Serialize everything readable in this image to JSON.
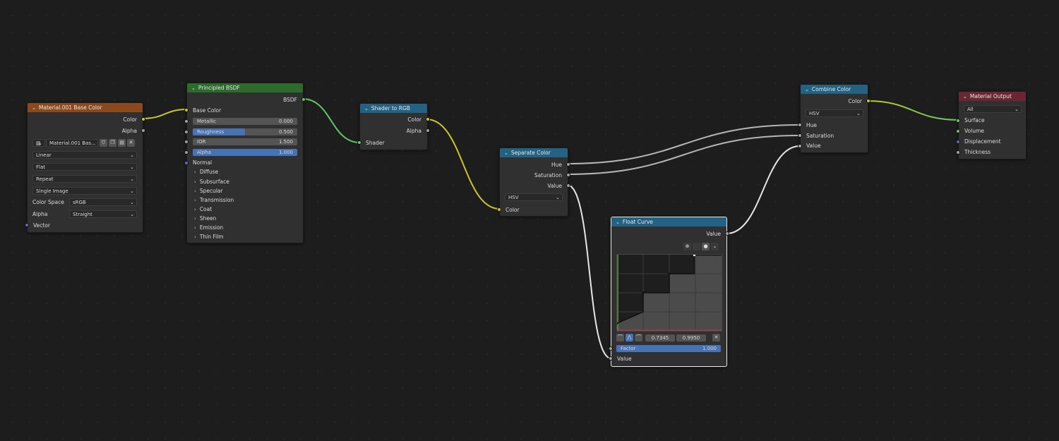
{
  "colors": {
    "wire_yellow": "#c7c729",
    "wire_green": "#63c763",
    "wire_grey": "#b5b5b5",
    "wire_white": "#e6e6e6",
    "accent": "#4772b3"
  },
  "image_node": {
    "title": "Material.001 Base Color",
    "out_color": "Color",
    "out_alpha": "Alpha",
    "image_name": "Material.001 Bas...",
    "interpolation": "Linear",
    "projection": "Flat",
    "extension": "Repeat",
    "source": "Single Image",
    "color_space_label": "Color Space",
    "color_space": "sRGB",
    "alpha_label": "Alpha",
    "alpha_mode": "Straight",
    "in_vector": "Vector",
    "icons": [
      "image-browse-icon",
      "fake-user-shield-icon",
      "duplicate-icon",
      "pack-icon",
      "close-icon"
    ]
  },
  "bsdf_node": {
    "title": "Principled BSDF",
    "out": "BSDF",
    "in_base_color": "Base Color",
    "fields": [
      {
        "label": "Metallic",
        "value": "0.000",
        "fill": 0
      },
      {
        "label": "Roughness",
        "value": "0.500",
        "fill": 0.5
      },
      {
        "label": "IOR",
        "value": "1.500",
        "fill": 0
      },
      {
        "label": "Alpha",
        "value": "1.000",
        "fill": 1
      }
    ],
    "in_normal": "Normal",
    "panels": [
      "Diffuse",
      "Subsurface",
      "Specular",
      "Transmission",
      "Coat",
      "Sheen",
      "Emission",
      "Thin Film"
    ]
  },
  "s2rgb_node": {
    "title": "Shader to RGB",
    "out_color": "Color",
    "out_alpha": "Alpha",
    "in_shader": "Shader"
  },
  "sep_node": {
    "title": "Separate Color",
    "out_hue": "Hue",
    "out_sat": "Saturation",
    "out_val": "Value",
    "mode": "HSV",
    "in_color": "Color"
  },
  "curve_node": {
    "title": "Float Curve",
    "out_value": "Value",
    "point_x": "0.7345",
    "point_y": "0.9950",
    "factor_label": "Factor",
    "factor_value": "1.000",
    "in_value": "Value",
    "curve_points": [
      [
        0,
        0.1
      ],
      [
        0.25,
        0.25
      ],
      [
        0.25,
        0.5
      ],
      [
        0.5,
        0.5
      ],
      [
        0.5,
        0.75
      ],
      [
        0.74,
        0.75
      ],
      [
        0.74,
        0.995
      ],
      [
        1,
        0.995
      ]
    ]
  },
  "combine_node": {
    "title": "Combine Color",
    "out_color": "Color",
    "mode": "HSV",
    "in_hue": "Hue",
    "in_sat": "Saturation",
    "in_val": "Value"
  },
  "output_node": {
    "title": "Material Output",
    "target": "All",
    "in_surface": "Surface",
    "in_volume": "Volume",
    "in_displacement": "Displacement",
    "in_thickness": "Thickness"
  }
}
